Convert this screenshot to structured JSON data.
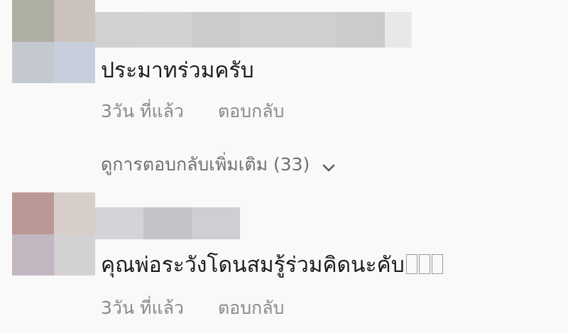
{
  "comments": [
    {
      "avatar_colors": [
        "#aeaea3",
        "#cbc1bd",
        "#c4c9d0",
        "#c7cfdc"
      ],
      "name_blur_colors": [
        "#d1d1d3",
        "#d2d2d4",
        "#cbcbcd",
        "#cfcfd1",
        "#cfcfd1",
        "#cbcbcd",
        "#e8e8e8"
      ],
      "text": "ประมาทร่วมครับ",
      "time": "3วัน ที่แล้ว",
      "reply_label": "ตอบกลับ"
    },
    {
      "avatar_colors": [
        "#bb9796",
        "#d7ceca",
        "#c2b6c1",
        "#d4d1d3"
      ],
      "name_blur_colors": [
        "#d4d3d8",
        "#c3c3c8",
        "#cfcfd3"
      ],
      "text": "คุณพ่อระวังโดนสมรู้ร่วมคิดนะคับ",
      "time": "3วัน ที่แล้ว",
      "reply_label": "ตอบกลับ"
    }
  ],
  "view_more_replies": "ดูการตอบกลับเพิ่มเติม (33)",
  "icons": {
    "more_replies": "chevron-down-icon"
  }
}
